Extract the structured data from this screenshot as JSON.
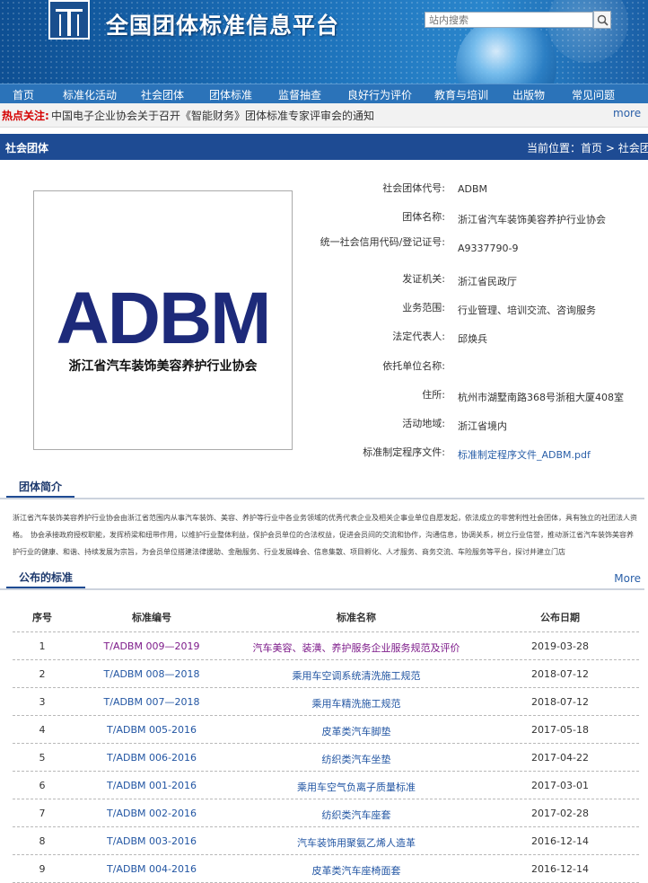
{
  "header": {
    "site_title": "全国团体标准信息平台",
    "search_placeholder": "站内搜索"
  },
  "nav": [
    "首页",
    "标准化活动",
    "社会团体",
    "团体标准",
    "监督抽查",
    "良好行为评价",
    "教育与培训",
    "出版物",
    "常见问题"
  ],
  "hot": {
    "label": "热点关注:",
    "text": "中国电子企业协会关于召开《智能财务》团体标准专家评审会的通知",
    "more": "more"
  },
  "section": {
    "title": "社会团体",
    "location_prefix": "当前位置：",
    "breadcrumb_home": "首页",
    "breadcrumb_sep": " > ",
    "breadcrumb_current": "社会团体"
  },
  "logo": {
    "abbr": "ADBM",
    "full_name": "浙江省汽车装饰美容养护行业协会"
  },
  "info": [
    {
      "label": "社会团体代号:",
      "value": "ADBM"
    },
    {
      "label": "团体名称:",
      "value": "浙江省汽车装饰美容养护行业协会"
    },
    {
      "label": "统一社会信用代码/登记证号:",
      "value": "A9337790-9"
    },
    {
      "label": "发证机关:",
      "value": "浙江省民政厅"
    },
    {
      "label": "业务范围:",
      "value": "行业管理、培训交流、咨询服务"
    },
    {
      "label": "法定代表人:",
      "value": "邱焕兵"
    },
    {
      "label": "依托单位名称:",
      "value": ""
    },
    {
      "label": "住所:",
      "value": "杭州市湖墅南路368号浙租大厦408室"
    },
    {
      "label": "活动地域:",
      "value": "浙江省境内"
    },
    {
      "label": "标准制定程序文件:",
      "value": "标准制定程序文件_ADBM.pdf"
    }
  ],
  "intro": {
    "title": "团体简介",
    "text": "浙江省汽车装饰美容养护行业协会由浙江省范围内从事汽车装饰、美容、养护等行业中各业务领域的优秀代表企业及相关企事业单位自愿发起，依法成立的非营利性社会团体，具有独立的社团法人资格。　协会承接政府授权职能，发挥桥梁和纽带作用，以维护行业整体利益，保护会员单位的合法权益，促进会员间的交流和协作，沟通信息，协调关系，树立行业信誉，推动浙江省汽车装饰美容养护行业的健康、和谐、持续发展为宗旨，为会员单位搭建法律援助、金融服务、行业发展峰会、信息集散、项目孵化、人才服务、商务交流、车险服务等平台，探讨并建立门店"
  },
  "standards": {
    "title": "公布的标准",
    "more": "More",
    "columns": [
      "序号",
      "标准编号",
      "标准名称",
      "公布日期"
    ],
    "rows": [
      {
        "no": "1",
        "code": "T/ADBM 009—2019",
        "name": "汽车美容、装潢、养护服务企业服务规范及评价",
        "date": "2019-03-28"
      },
      {
        "no": "2",
        "code": "T/ADBM 008—2018",
        "name": "乘用车空调系统清洗施工规范",
        "date": "2018-07-12"
      },
      {
        "no": "3",
        "code": "T/ADBM 007—2018",
        "name": "乘用车精洗施工规范",
        "date": "2018-07-12"
      },
      {
        "no": "4",
        "code": "T/ADBM 005-2016",
        "name": "皮革类汽车脚垫",
        "date": "2017-05-18"
      },
      {
        "no": "5",
        "code": "T/ADBM 006-2016",
        "name": "纺织类汽车坐垫",
        "date": "2017-04-22"
      },
      {
        "no": "6",
        "code": "T/ADBM 001-2016",
        "name": "乘用车空气负离子质量标准",
        "date": "2017-03-01"
      },
      {
        "no": "7",
        "code": "T/ADBM 002-2016",
        "name": "纺织类汽车座套",
        "date": "2017-02-28"
      },
      {
        "no": "8",
        "code": "T/ADBM 003-2016",
        "name": "汽车装饰用聚氨乙烯人造革",
        "date": "2016-12-14"
      },
      {
        "no": "9",
        "code": "T/ADBM 004-2016",
        "name": "皮革类汽车座椅面套",
        "date": "2016-12-14"
      }
    ]
  }
}
